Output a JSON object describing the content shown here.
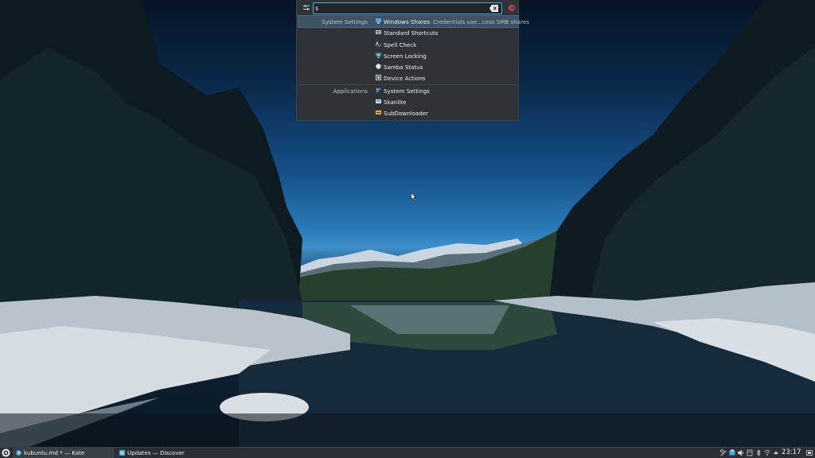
{
  "krunner": {
    "query": "s",
    "results": [
      {
        "category": "System Settings",
        "title": "Windows Shares",
        "subtitle": "Credentials use...cess SMB shares",
        "icon": "network-share-icon",
        "selected": true
      },
      {
        "category": "",
        "title": "Standard Shortcuts",
        "subtitle": "",
        "icon": "keyboard-icon"
      },
      {
        "category": "",
        "title": "Spell Check",
        "subtitle": "",
        "icon": "spellcheck-icon"
      },
      {
        "category": "",
        "title": "Screen Locking",
        "subtitle": "",
        "icon": "screen-lock-icon"
      },
      {
        "category": "",
        "title": "Samba Status",
        "subtitle": "",
        "icon": "samba-icon"
      },
      {
        "category": "",
        "title": "Device Actions",
        "subtitle": "",
        "icon": "device-actions-icon"
      },
      {
        "category": "Applications",
        "title": "System Settings",
        "subtitle": "",
        "icon": "system-settings-icon"
      },
      {
        "category": "",
        "title": "Skanlite",
        "subtitle": "",
        "icon": "scanner-icon"
      },
      {
        "category": "",
        "title": "SubDownloader",
        "subtitle": "",
        "icon": "subtitle-download-icon"
      }
    ]
  },
  "taskbar": {
    "tasks": [
      {
        "label": "kubuntu.md * — Kate",
        "active": true,
        "icon": "kate-icon"
      },
      {
        "label": "Updates — Discover",
        "active": false,
        "icon": "discover-icon"
      }
    ],
    "clock": "23:17"
  },
  "colors": {
    "accent": "#3daee9",
    "panel": "#2f3337",
    "close": "#da4453"
  }
}
